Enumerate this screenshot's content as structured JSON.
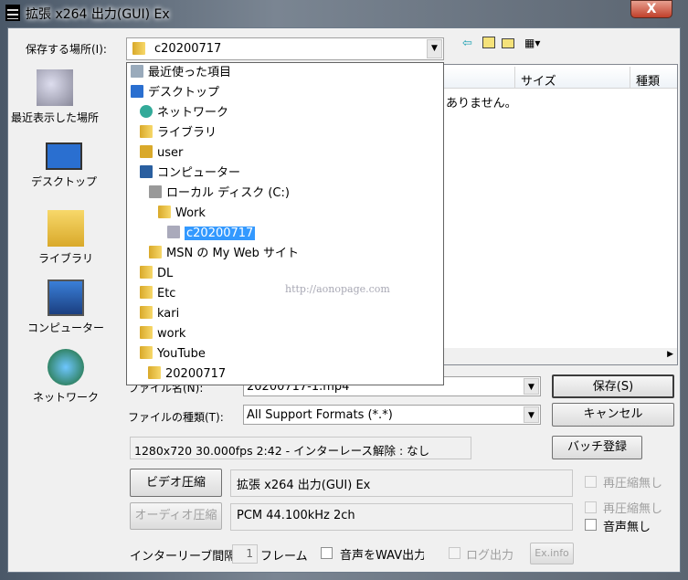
{
  "window": {
    "title": "拡張 x264 出力(GUI) Ex",
    "close": "X"
  },
  "location": {
    "label": "保存する場所(I):",
    "value": "c20200717"
  },
  "toolbar_icons": [
    "back-icon",
    "up-folder-icon",
    "new-folder-icon",
    "view-menu-icon"
  ],
  "places": [
    {
      "label": "最近表示した場所",
      "icon": "recent-icon"
    },
    {
      "label": "デスクトップ",
      "icon": "desktop-icon"
    },
    {
      "label": "ライブラリ",
      "icon": "library-icon"
    },
    {
      "label": "コンピューター",
      "icon": "computer-icon"
    },
    {
      "label": "ネットワーク",
      "icon": "network-icon"
    }
  ],
  "file_list": {
    "columns": [
      "サイズ",
      "種類"
    ],
    "empty_text": "ありません。",
    "watermark": "http://aonopage.com"
  },
  "dropdown": [
    {
      "label": "最近使った項目",
      "indent": 0,
      "icon": "recent-icon"
    },
    {
      "label": "デスクトップ",
      "indent": 0,
      "icon": "desktop-icon"
    },
    {
      "label": "ネットワーク",
      "indent": 1,
      "icon": "network-icon"
    },
    {
      "label": "ライブラリ",
      "indent": 1,
      "icon": "library-icon"
    },
    {
      "label": "user",
      "indent": 1,
      "icon": "user-icon"
    },
    {
      "label": "コンピューター",
      "indent": 1,
      "icon": "computer-icon"
    },
    {
      "label": "ローカル ディスク (C:)",
      "indent": 2,
      "icon": "drive-icon"
    },
    {
      "label": "Work",
      "indent": 3,
      "icon": "folder-icon"
    },
    {
      "label": "c20200717",
      "indent": 4,
      "icon": "folder-icon",
      "selected": true
    },
    {
      "label": "MSN の My Web サイト",
      "indent": 2,
      "icon": "folder-icon"
    },
    {
      "label": "DL",
      "indent": 1,
      "icon": "folder-icon"
    },
    {
      "label": "Etc",
      "indent": 1,
      "icon": "folder-icon"
    },
    {
      "label": "kari",
      "indent": 1,
      "icon": "folder-icon"
    },
    {
      "label": "work",
      "indent": 1,
      "icon": "folder-icon"
    },
    {
      "label": "YouTube",
      "indent": 1,
      "icon": "folder-icon"
    },
    {
      "label": "20200717",
      "indent": 2,
      "icon": "folder-icon"
    }
  ],
  "filename": {
    "label": "ファイル名(N):",
    "value": "20200717-1.mp4"
  },
  "filetype": {
    "label": "ファイルの種類(T):",
    "value": "All Support Formats (*.*)"
  },
  "buttons": {
    "save": "保存(S)",
    "cancel": "キャンセル",
    "batch": "バッチ登録",
    "video": "ビデオ圧縮",
    "audio": "オーディオ圧縮",
    "exinfo": "Ex.info"
  },
  "info": "1280x720  30.000fps  2:42  -  インターレース解除 : なし",
  "video_codec": "拡張 x264 出力(GUI) Ex",
  "audio_codec": "PCM 44.100kHz 2ch",
  "checks": {
    "video_norecomp": "再圧縮無し",
    "audio_norecomp": "再圧縮無し",
    "no_audio": "音声無し",
    "wav_out": "音声をWAV出力",
    "log_out": "ログ出力"
  },
  "interleave": {
    "label": "インターリーブ間隔",
    "value": "1",
    "unit": "フレーム"
  }
}
